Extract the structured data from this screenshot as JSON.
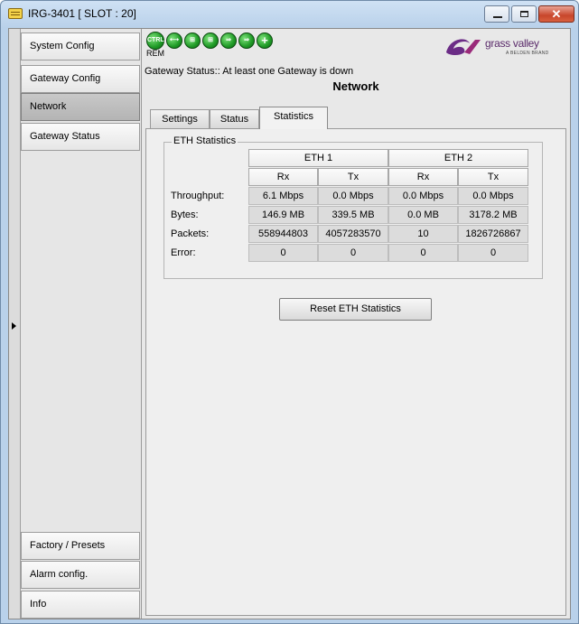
{
  "window": {
    "title": "IRG-3401 [ SLOT : 20]"
  },
  "nav": {
    "items": [
      {
        "label": "System Config"
      },
      {
        "label": "Gateway Config"
      },
      {
        "label": "Network"
      },
      {
        "label": "Gateway Status"
      },
      {
        "label": "Factory / Presets"
      },
      {
        "label": "Alarm config."
      },
      {
        "label": "Info"
      }
    ],
    "active": "Network"
  },
  "header": {
    "indicators": [
      {
        "name": "ctrl-indicator",
        "label": "CTRL",
        "color": "#2ea82f"
      },
      {
        "name": "link-indicator",
        "color": "#2ea82f"
      },
      {
        "name": "network-indicator-1",
        "color": "#2ea82f"
      },
      {
        "name": "network-indicator-2",
        "color": "#2ea82f"
      },
      {
        "name": "arrow-indicator-1",
        "color": "#2ea82f"
      },
      {
        "name": "arrow-indicator-2",
        "color": "#2ea82f"
      },
      {
        "name": "plus-indicator",
        "color": "#2ea82f"
      }
    ],
    "rem_label": "REM",
    "logo": {
      "text": "grass valley",
      "subtext": "A BELDEN BRAND"
    },
    "gateway_status": "Gateway Status:: At least one Gateway is down",
    "page_title": "Network"
  },
  "tabs": [
    {
      "label": "Settings"
    },
    {
      "label": "Status"
    },
    {
      "label": "Statistics"
    }
  ],
  "active_tab": "Statistics",
  "eth_statistics": {
    "title": "ETH Statistics",
    "groups": [
      "ETH 1",
      "ETH 2"
    ],
    "columns": [
      "Rx",
      "Tx",
      "Rx",
      "Tx"
    ],
    "rows": [
      {
        "label": "Throughput:",
        "values": [
          "6.1 Mbps",
          "0.0 Mbps",
          "0.0 Mbps",
          "0.0 Mbps"
        ]
      },
      {
        "label": "Bytes:",
        "values": [
          "146.9 MB",
          "339.5 MB",
          "0.0 MB",
          "3178.2 MB"
        ]
      },
      {
        "label": "Packets:",
        "values": [
          "558944803",
          "4057283570",
          "10",
          "1826726867"
        ]
      },
      {
        "label": "Error:",
        "values": [
          "0",
          "0",
          "0",
          "0"
        ]
      }
    ]
  },
  "reset_button": {
    "label": "Reset ETH Statistics"
  }
}
